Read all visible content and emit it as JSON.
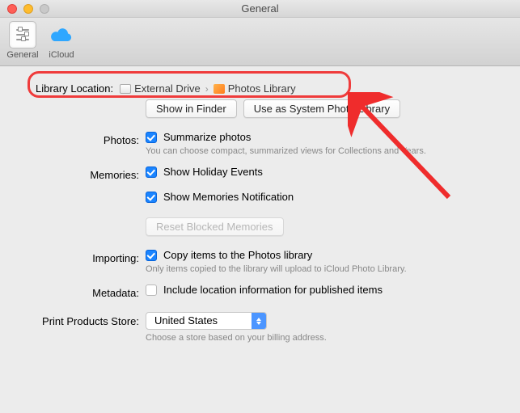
{
  "window": {
    "title": "General"
  },
  "toolbar": {
    "general": "General",
    "icloud": "iCloud"
  },
  "library_location": {
    "label": "Library Location:",
    "crumb1": "External Drive",
    "crumb2": "Photos Library"
  },
  "buttons": {
    "show_in_finder": "Show in Finder",
    "use_system": "Use as System Photo Library",
    "reset_blocked": "Reset Blocked Memories"
  },
  "photos": {
    "label": "Photos:",
    "summarize": "Summarize photos",
    "hint": "You can choose compact, summarized views for Collections and Years."
  },
  "memories": {
    "label": "Memories:",
    "holiday": "Show Holiday Events",
    "notif": "Show Memories Notification"
  },
  "importing": {
    "label": "Importing:",
    "copy": "Copy items to the Photos library",
    "hint": "Only items copied to the library will upload to iCloud Photo Library."
  },
  "metadata": {
    "label": "Metadata:",
    "include": "Include location information for published items"
  },
  "store": {
    "label": "Print Products Store:",
    "value": "United States",
    "hint": "Choose a store based on your billing address."
  }
}
